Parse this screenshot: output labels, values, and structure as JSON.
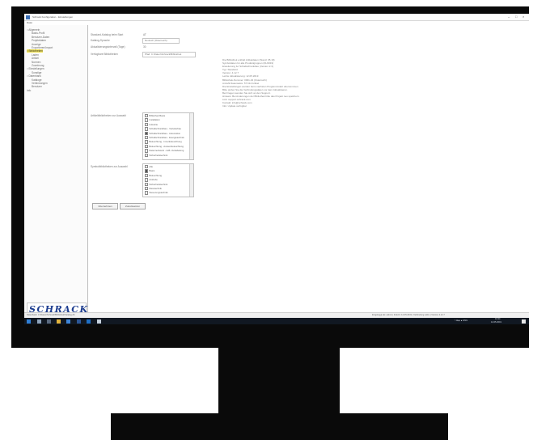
{
  "window": {
    "title": "Schrack Konfiguration - Einstellungen",
    "controls": [
      "–",
      "□",
      "×"
    ]
  },
  "menubar": {
    "label": "Datei"
  },
  "sidebar": {
    "items": [
      {
        "label": "▿ Allgemein",
        "indent": 0,
        "selected": false
      },
      {
        "label": "Basis-Profil",
        "indent": 2,
        "selected": false
      },
      {
        "label": "Benutzer-Daten",
        "indent": 2,
        "selected": false
      },
      {
        "label": "Projektdaten",
        "indent": 2,
        "selected": false
      },
      {
        "label": "Anzeige",
        "indent": 2,
        "selected": false
      },
      {
        "label": "Exportieren/Import",
        "indent": 2,
        "selected": false
      },
      {
        "label": "▿ Bibliotheken",
        "indent": 0,
        "selected": true
      },
      {
        "label": "Laden",
        "indent": 2,
        "selected": false
      },
      {
        "label": "Artikel",
        "indent": 2,
        "selected": false
      },
      {
        "label": "Normen",
        "indent": 2,
        "selected": false
      },
      {
        "label": "Zuordnung",
        "indent": 2,
        "selected": false
      },
      {
        "label": "▿ Einstellungen",
        "indent": 0,
        "selected": false
      },
      {
        "label": "Sonstige",
        "indent": 2,
        "selected": false
      },
      {
        "label": "▿ Datenbank",
        "indent": 0,
        "selected": false
      },
      {
        "label": "Kataloge",
        "indent": 2,
        "selected": false
      },
      {
        "label": "Verbindungen",
        "indent": 2,
        "selected": false
      },
      {
        "label": "Benutzer",
        "indent": 2,
        "selected": false
      },
      {
        "label": "Info",
        "indent": 0,
        "selected": false
      }
    ],
    "logo_word": "SCHRACK",
    "logo_sub": "TECHNIK"
  },
  "form": {
    "rows": [
      {
        "label": "Standard-Katalog beim Start",
        "value": "AT"
      },
      {
        "label": "Katalog-Sprache",
        "value": "Deutsch (Osterreich)"
      },
      {
        "label": "Aktualisierungsintervall (Tage)",
        "value": "30"
      },
      {
        "label": "Verfugbare Bibliotheken",
        "value": "Pfad: C:\\Daten\\Schrack\\Bibliothek"
      }
    ],
    "description_lines": [
      "Die Bibliothek enthalt Artikeldaten (Stand: 05.19)",
      "Symboldaten fur alle Produktgruppen (01/2019)",
      "Erweiterung fur Schaltschrankbau (Version 2.3)",
      "Typ: Standard",
      "Version: 4.12.7",
      "Letzte Aktualisierung: 12.05.2019",
      "Bibliothek-Nummer: 0001-04 (Osterreich)",
      "Anzahl Datensatze: 57.614 Artikel",
      "Die Einstellungen werden beim nachsten Programmstart ubernommen.",
      "Bitte prufen Sie die Verbindungsdaten vor dem Aktualisieren.",
      "Bei Fragen wenden Sie sich an den Support.",
      "Hinweis: Bei Anderungen der Bibliothek bitte das Projekt neu speichern.",
      "Link: support.schrack.com",
      "Kontakt: info@schrack.com",
      "Info: Update verfugbar"
    ],
    "list1": {
      "label": "Artikelbibliotheken zur Auswahl",
      "items": [
        {
          "text": "Bibliothek Basis",
          "checked": false
        },
        {
          "text": "Installation",
          "checked": false
        },
        {
          "text": "Industrie",
          "checked": false
        },
        {
          "text": "Schaltschrankbau - Verteilerbau",
          "checked": false
        },
        {
          "text": "Schaltschrankbau - Automation",
          "checked": true
        },
        {
          "text": "Schaltschrankbau - Energietechnik",
          "checked": false
        },
        {
          "text": "Beleuchtung - Innenbeleuchtung",
          "checked": false
        },
        {
          "text": "Beleuchtung - Aussenbeleuchtung",
          "checked": false
        },
        {
          "text": "Datennetzwerk - LWL Verkabelung",
          "checked": false
        },
        {
          "text": "Sicherheitstechnik",
          "checked": false
        }
      ]
    },
    "list2": {
      "label": "Symbolbibliotheken zur Auswahl",
      "items": [
        {
          "text": "Alle",
          "checked": false
        },
        {
          "text": "Basis",
          "checked": true
        },
        {
          "text": "Beleuchtung",
          "checked": false
        },
        {
          "text": "Antriebe",
          "checked": false
        },
        {
          "text": "Sicherheitstechnik",
          "checked": false
        },
        {
          "text": "Messtechnik",
          "checked": false
        },
        {
          "text": "Steuerungstechnik",
          "checked": false
        }
      ]
    },
    "buttons": {
      "apply": "Ubernehmen",
      "reset": "Zurucksetzen"
    }
  },
  "statusbar": {
    "left": "Datenbank: C:\\Daten\\Schrack\\Bibliothek\\Katalog.db",
    "right": "Eingeloggt als: admin | Zuletzt: 12.05.2019 | Verbindung: aktiv | Version 4.12.7"
  },
  "taskbar": {
    "clock_time": "10:24",
    "clock_date": "12.05.2019",
    "tray": "˄  ■  ◆  ▲  ENG"
  },
  "colors": {
    "selection": "#f3e55b",
    "logo": "#1d3d8f",
    "taskbar": "#111822",
    "frame": "#0a0a0a"
  }
}
